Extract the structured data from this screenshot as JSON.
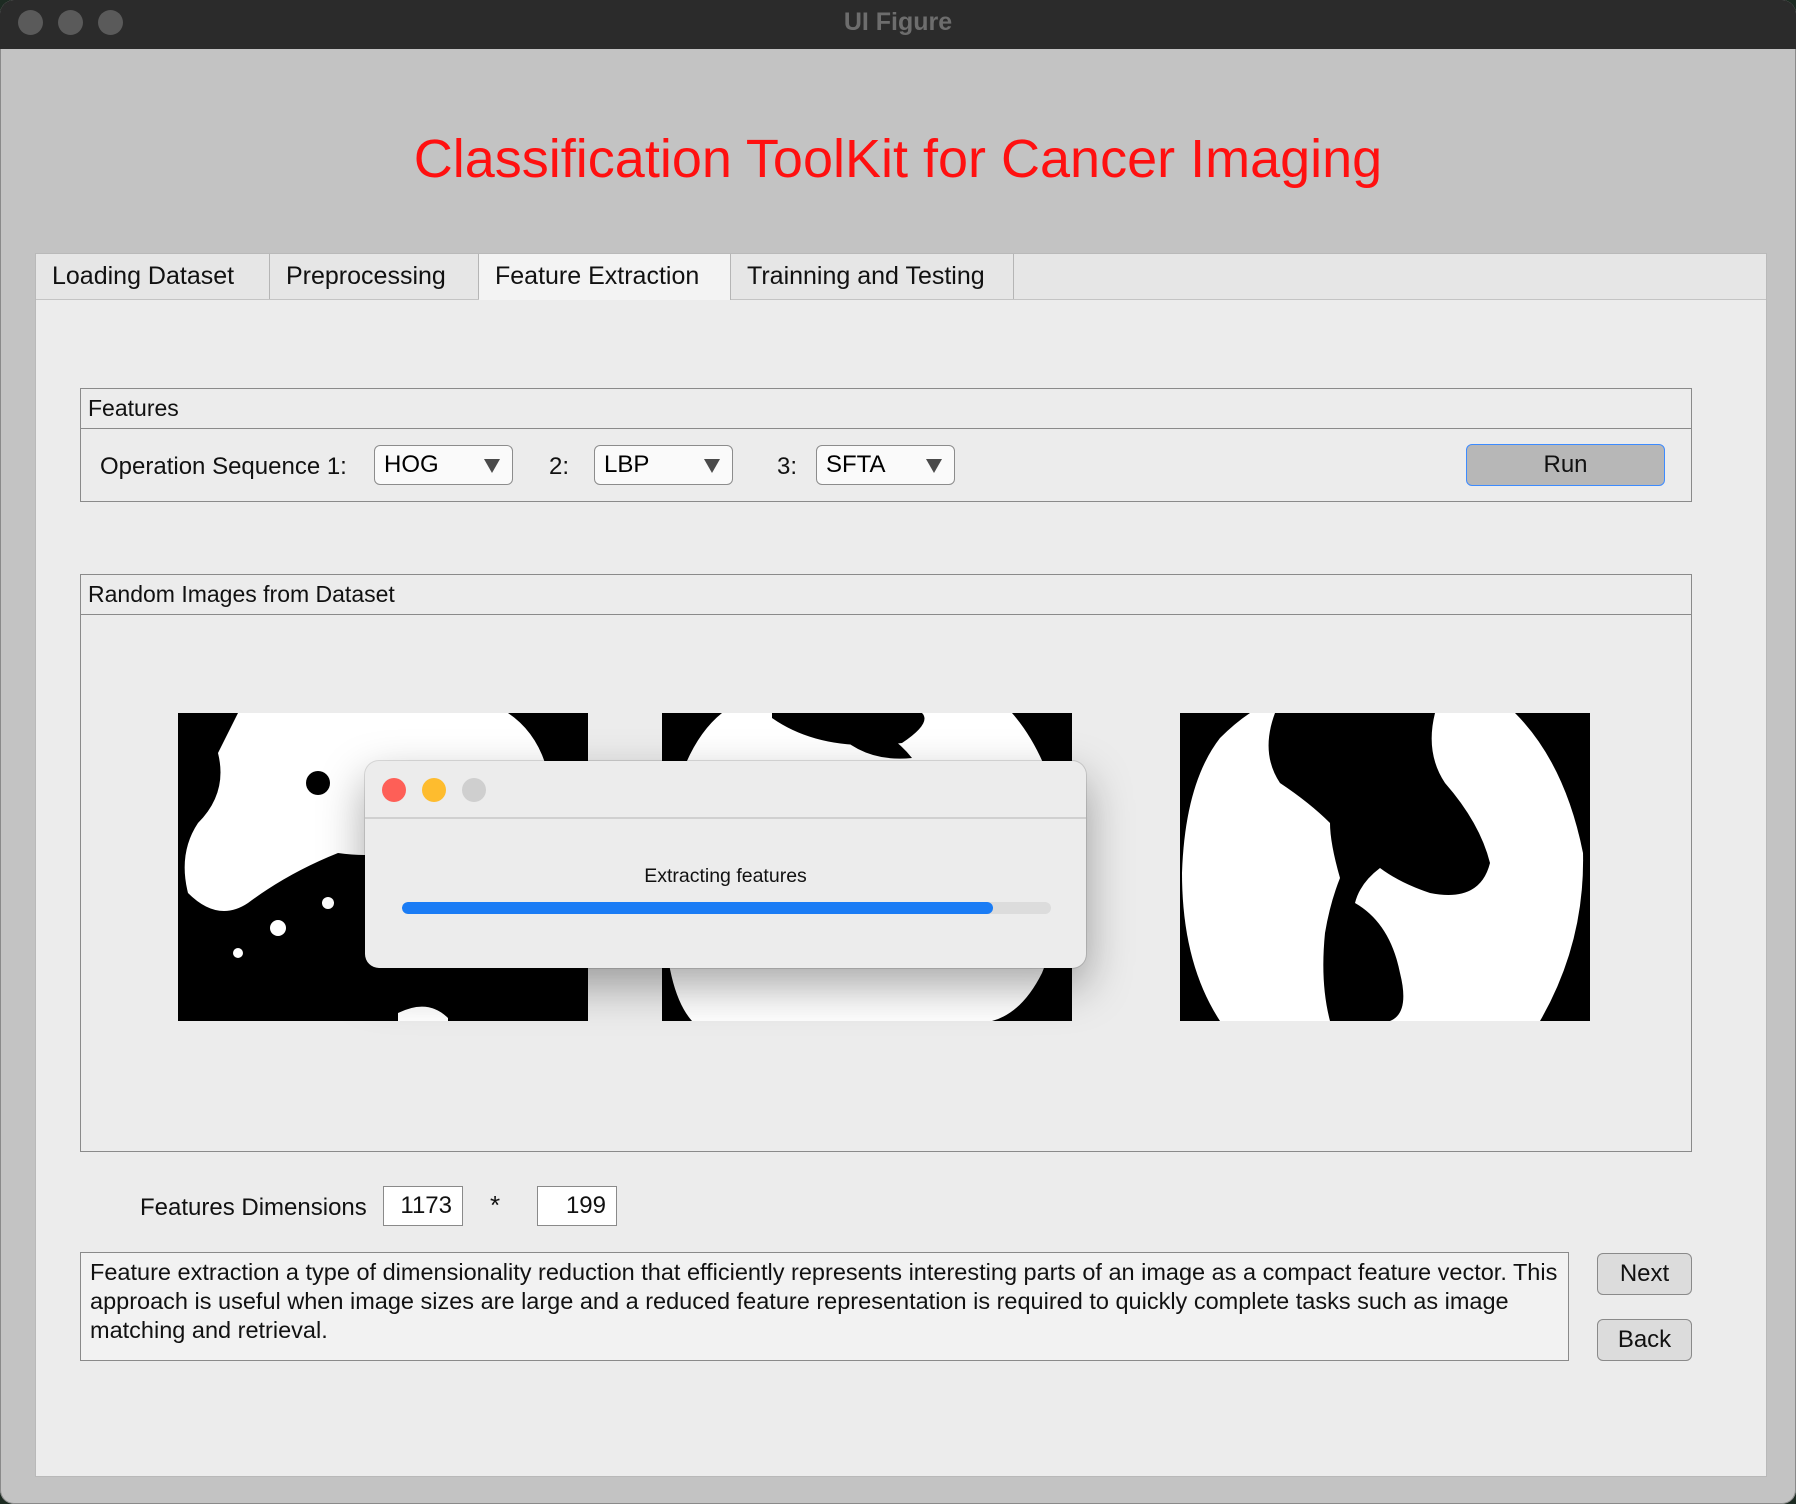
{
  "window": {
    "title": "UI Figure"
  },
  "app": {
    "title": "Classification ToolKit for Cancer Imaging"
  },
  "tabs": [
    {
      "label": "Loading Dataset"
    },
    {
      "label": "Preprocessing"
    },
    {
      "label": "Feature Extraction"
    },
    {
      "label": "Trainning and Testing"
    }
  ],
  "active_tab": "Feature Extraction",
  "features_panel": {
    "title": "Features",
    "sequence_label": "Operation Sequence 1:",
    "step2_label": "2:",
    "step3_label": "3:",
    "dropdowns": [
      {
        "value": "HOG"
      },
      {
        "value": "LBP"
      },
      {
        "value": "SFTA"
      }
    ],
    "run_label": "Run"
  },
  "images_panel": {
    "title": "Random Images from Dataset"
  },
  "dimensions": {
    "label": "Features Dimensions",
    "rows": "1173",
    "separator": "*",
    "cols": "199"
  },
  "description": "Feature extraction a type of dimensionality reduction that efficiently represents interesting parts of an image as a compact feature vector. This approach is useful when image sizes are large and a reduced feature representation is required to quickly complete tasks such as image matching and retrieval.",
  "buttons": {
    "next": "Next",
    "back": "Back"
  },
  "progress_dialog": {
    "message": "Extracting features",
    "progress": 0.91,
    "colors": {
      "close": "#fe5f57",
      "minimize": "#febc2e",
      "zoom": "#cfcfcf",
      "bar": "#1a7cf5"
    }
  },
  "colors": {
    "title_text": "#ff1010",
    "run_focus": "#3d8bff"
  }
}
